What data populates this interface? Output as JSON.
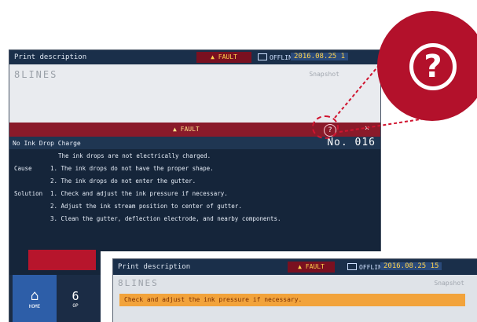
{
  "screen_main": {
    "header": {
      "title": "Print description",
      "fault": "FAULT",
      "status": "OFFLINE",
      "timestamp": "2016.08.25 1"
    },
    "message": {
      "lines": "8LINES",
      "snapshot": "Snapshot"
    },
    "fault_bar": {
      "label": "FAULT",
      "help": "?",
      "close": "×"
    },
    "error": {
      "name": "No Ink Drop Charge",
      "number": "No. 016"
    },
    "details": {
      "summary": "The ink drops are not electrically charged.",
      "cause_label": "Cause",
      "cause_1": "1. The ink drops do not have the proper shape.",
      "cause_2": "2. The ink drops do not enter the gutter.",
      "solution_label": "Solution",
      "solution_1": "1. Check and adjust the ink pressure if necessary.",
      "solution_2": "2. Adjust the ink stream position to center of gutter.",
      "solution_3": "3. Clean the gutter, deflection electrode, and nearby components."
    },
    "nav": {
      "home_label": "HOME",
      "home_icon": "home-icon",
      "second_label": "OP",
      "second_icon": "6"
    }
  },
  "screen_secondary": {
    "header": {
      "title": "Print description",
      "fault": "FAULT",
      "status": "OFFLINE",
      "timestamp": "2016.08.25 15"
    },
    "lines": "8LINES",
    "snapshot": "Snapshot",
    "warning_text": "Check and adjust the ink pressure if necessary."
  },
  "zoom_callout": {
    "icon": "?"
  },
  "colors": {
    "brand_red": "#b3112b",
    "dark_navy": "#15253a",
    "fault_red": "#8a1a2a",
    "accent_blue": "#2d5ea8",
    "warning_orange": "#f2a33b"
  }
}
